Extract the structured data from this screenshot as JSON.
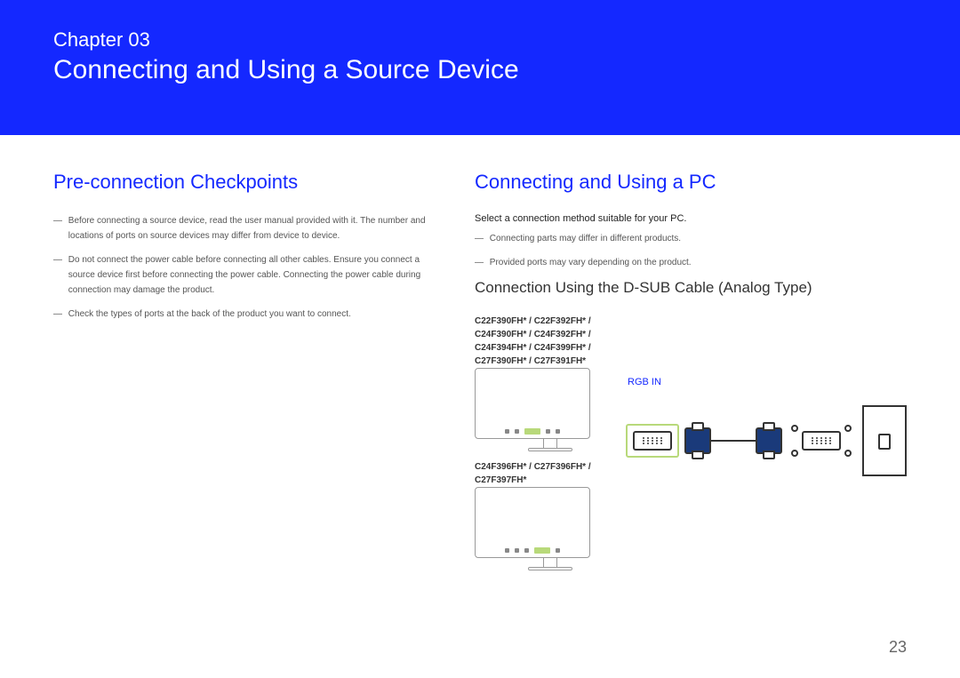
{
  "banner": {
    "chapter_label": "Chapter 03",
    "chapter_title": "Connecting and Using a Source Device"
  },
  "left": {
    "heading": "Pre-connection Checkpoints",
    "notes": [
      "Before connecting a source device, read the user manual provided with it.\nThe number and locations of ports on source devices may differ from device to device.",
      "Do not connect the power cable before connecting all other cables.\nEnsure you connect a source device first before connecting the power cable.\nConnecting the power cable during connection may damage the product.",
      "Check the types of ports at the back of the product you want to connect."
    ]
  },
  "right": {
    "heading": "Connecting and Using a PC",
    "lead": "Select a connection method suitable for your PC.",
    "notes": [
      "Connecting parts may differ in different products.",
      "Provided ports may vary depending on the product."
    ],
    "subheading": "Connection Using the D-SUB Cable (Analog Type)",
    "models1": "C22F390FH* / C22F392FH* / C24F390FH* / C24F392FH* / C24F394FH* / C24F399FH* / C27F390FH* / C27F391FH*",
    "models2": "C24F396FH* / C27F396FH* / C27F397FH*",
    "rgb_label": "RGB IN"
  },
  "page_number": "23"
}
